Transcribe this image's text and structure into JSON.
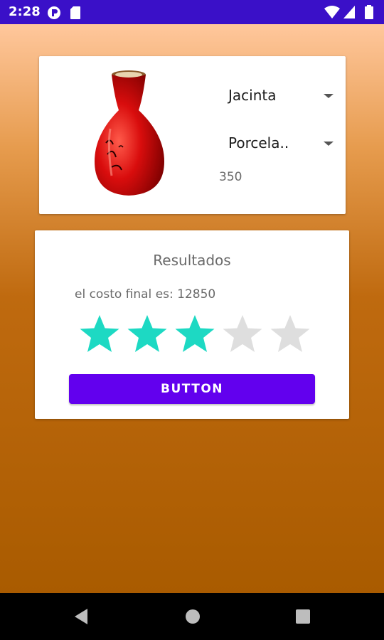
{
  "status_bar": {
    "time": "2:28",
    "icons": [
      "notification-app-icon",
      "sd-card-icon",
      "wifi-icon",
      "signal-icon",
      "battery-icon"
    ]
  },
  "product": {
    "image": "red-vase-icon",
    "name_spinner": {
      "selected": "Jacinta"
    },
    "material_spinner": {
      "selected": "Porcela.."
    },
    "price": "350"
  },
  "results": {
    "title": "Resultados",
    "cost_text": "el costo final es: 12850",
    "rating": {
      "value": 3,
      "max": 5
    },
    "button_label": "BUTTON"
  },
  "colors": {
    "status_bar": "#3a10c8",
    "button": "#6200ee",
    "star_filled": "#1dd9c3",
    "star_empty": "#dedede",
    "gradient_top": "#ffc79c",
    "gradient_bottom": "#a95b00"
  },
  "nav_bar": {
    "icons": [
      "back-icon",
      "home-icon",
      "recents-icon"
    ]
  }
}
